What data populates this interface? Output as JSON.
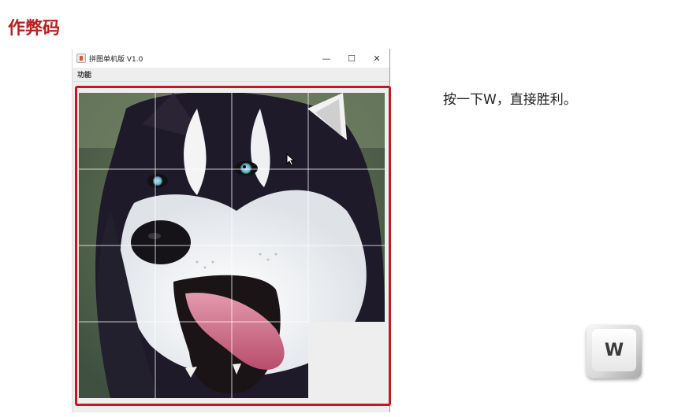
{
  "slide": {
    "title": "作弊码",
    "tip": "按一下W，直接胜利。"
  },
  "window": {
    "title": "拼图单机版 V1.0",
    "minimize_glyph": "—",
    "maximize_glyph": "☐",
    "close_glyph": "✕",
    "menu_function": "功能"
  },
  "puzzle": {
    "image_subject": "husky dog face",
    "grid": "4x4",
    "empty_tile": "row 4, column 4"
  },
  "key": {
    "label": "W"
  },
  "colors": {
    "title_red": "#b8211f",
    "highlight_red": "#c4181f",
    "panel_gray": "#eeeeee"
  },
  "icons": [
    "java-app-icon",
    "minimize-icon",
    "maximize-icon",
    "close-icon",
    "mouse-cursor-icon",
    "keyboard-key-icon"
  ]
}
